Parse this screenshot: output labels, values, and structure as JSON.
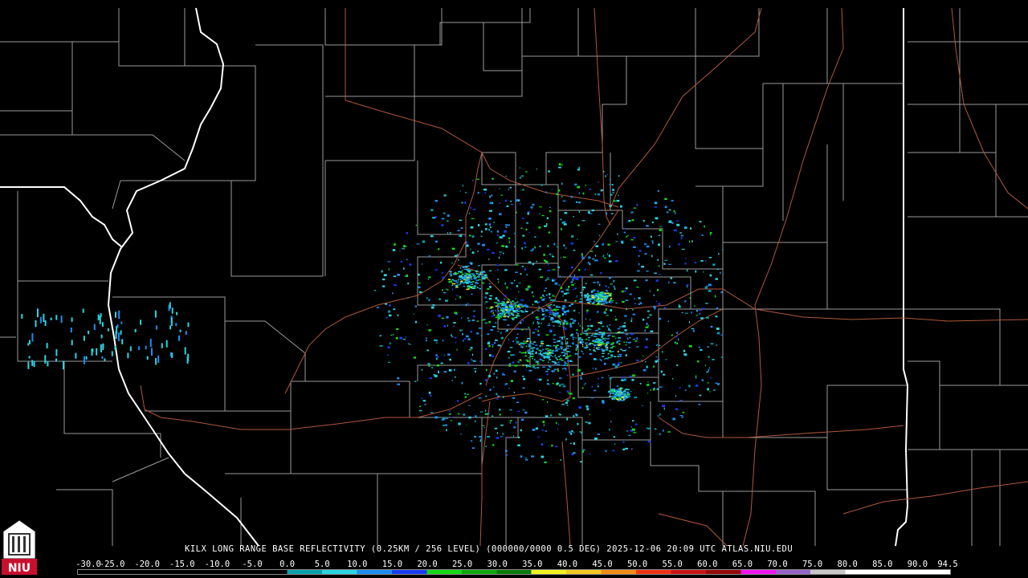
{
  "product_title": "KILX LONG RANGE BASE REFLECTIVITY (0.25KM / 256 LEVEL) (000000/0000 0.5 DEG) 2025-12-06 20:09 UTC  ATLAS.NIU.EDU",
  "logo_text": "NIU",
  "colors": {
    "background": "#000000",
    "county_lines": "#9a9a9a",
    "state_lines": "#ffffff",
    "roads": "#b0583a"
  },
  "scale": {
    "labels": [
      "-30.0",
      "-25.0",
      "-20.0",
      "-15.0",
      "-10.0",
      "-5.0",
      "0.0",
      "5.0",
      "10.0",
      "15.0",
      "20.0",
      "25.0",
      "30.0",
      "35.0",
      "40.0",
      "45.0",
      "50.0",
      "55.0",
      "60.0",
      "65.0",
      "70.0",
      "75.0",
      "80.0",
      "85.0",
      "90.0",
      "94.5"
    ],
    "colors": [
      "#000000",
      "#000000",
      "#000000",
      "#000000",
      "#000000",
      "#000000",
      "#08a0a8",
      "#2ad4e0",
      "#1d8cf0",
      "#1a3cf0",
      "#14d814",
      "#0fa80f",
      "#0a7a0a",
      "#f0f01e",
      "#f0c81e",
      "#f08c14",
      "#f03214",
      "#c81414",
      "#960a0a",
      "#f014f0",
      "#9664c8",
      "#c8c8c8",
      "#ffffff",
      "#ffffff",
      "#ffffff"
    ]
  }
}
